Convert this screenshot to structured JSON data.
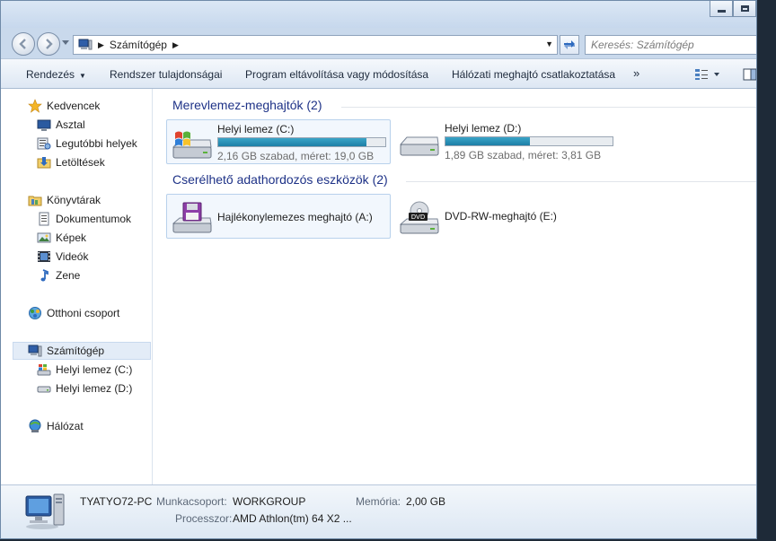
{
  "address": {
    "crumb": "Számítógép"
  },
  "search": {
    "placeholder": "Keresés: Számítógép"
  },
  "toolbar": {
    "organize": "Rendezés",
    "system_properties": "Rendszer tulajdonságai",
    "uninstall": "Program eltávolítása vagy módosítása",
    "map_drive": "Hálózati meghajtó csatlakoztatása",
    "more": "»"
  },
  "sidebar": {
    "favorites": "Kedvencek",
    "desktop": "Asztal",
    "recent": "Legutóbbi helyek",
    "downloads": "Letöltések",
    "libraries": "Könyvtárak",
    "documents": "Dokumentumok",
    "pictures": "Képek",
    "videos": "Videók",
    "music": "Zene",
    "homegroup": "Otthoni csoport",
    "computer": "Számítógép",
    "drive_c": "Helyi lemez (C:)",
    "drive_d": "Helyi lemez (D:)",
    "network": "Hálózat"
  },
  "groups": {
    "hdd": "Merevlemez-meghajtók (2)",
    "removable": "Cserélhető adathordozós eszközök (2)"
  },
  "drives": [
    {
      "name": "Helyi lemez (C:)",
      "info": "2,16 GB szabad, méret: 19,0 GB",
      "used_fraction": 0.886
    },
    {
      "name": "Helyi lemez (D:)",
      "info": "1,89 GB szabad, méret: 3,81 GB",
      "used_fraction": 0.504
    }
  ],
  "removable": [
    {
      "name": "Hajlékonylemezes meghajtó (A:)"
    },
    {
      "name": "DVD-RW-meghajtó (E:)",
      "badge": "DVD"
    }
  ],
  "details": {
    "pc_name": "TYATYO72-PC",
    "workgroup_label": "Munkacsoport:",
    "workgroup": "WORKGROUP",
    "memory_label": "Memória:",
    "memory": "2,00 GB",
    "processor_label": "Processzor:",
    "processor": "AMD Athlon(tm) 64 X2 ..."
  },
  "colors": {
    "group_heading": "#1e3287",
    "bar_fill": "#1d7fa6",
    "selection": "#e3ecf7"
  }
}
